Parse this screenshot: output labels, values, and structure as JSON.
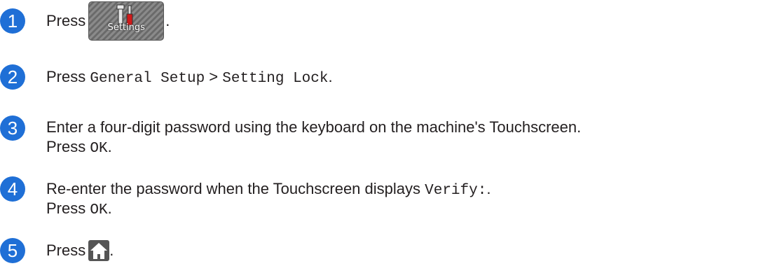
{
  "steps": [
    {
      "number": "1",
      "text_before": "Press",
      "icon_label": "Settings",
      "text_after": "."
    },
    {
      "number": "2",
      "text_before": "Press ",
      "mono1": "General Setup",
      "sep": " > ",
      "mono2": "Setting Lock",
      "text_after": "."
    },
    {
      "number": "3",
      "line1": "Enter a four-digit password using the keyboard on the machine's Touchscreen.",
      "line2_before": "Press ",
      "line2_mono": "OK",
      "line2_after": "."
    },
    {
      "number": "4",
      "line1_before": "Re-enter the password when the Touchscreen displays ",
      "line1_mono": "Verify:",
      "line1_after": ".",
      "line2_before": "Press ",
      "line2_mono": "OK",
      "line2_after": "."
    },
    {
      "number": "5",
      "text_before": "Press",
      "text_after": "."
    }
  ],
  "colors": {
    "step_circle": "#1f6fd6",
    "text": "#231f20"
  },
  "icons": {
    "step1": "settings-icon",
    "step5": "home-icon"
  }
}
